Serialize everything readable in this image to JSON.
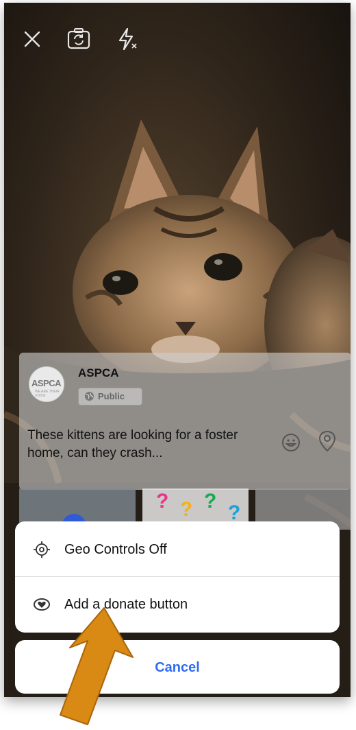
{
  "post": {
    "page_name": "ASPCA",
    "logo_text": "ASPCA",
    "logo_subtext": "WE ARE THEIR VOICE",
    "privacy": "Public",
    "text": "These kittens are looking for a foster home, can they crash..."
  },
  "sheet": {
    "items": [
      {
        "label": "Geo Controls Off",
        "icon": "crosshair-icon"
      },
      {
        "label": "Add a donate button",
        "icon": "donate-heart-icon"
      }
    ],
    "cancel_label": "Cancel"
  },
  "top_icons": [
    "close-icon",
    "camera-flip-icon",
    "flash-off-icon"
  ],
  "colors": {
    "accent": "#2f6cf1",
    "arrow": "#d88a14"
  }
}
